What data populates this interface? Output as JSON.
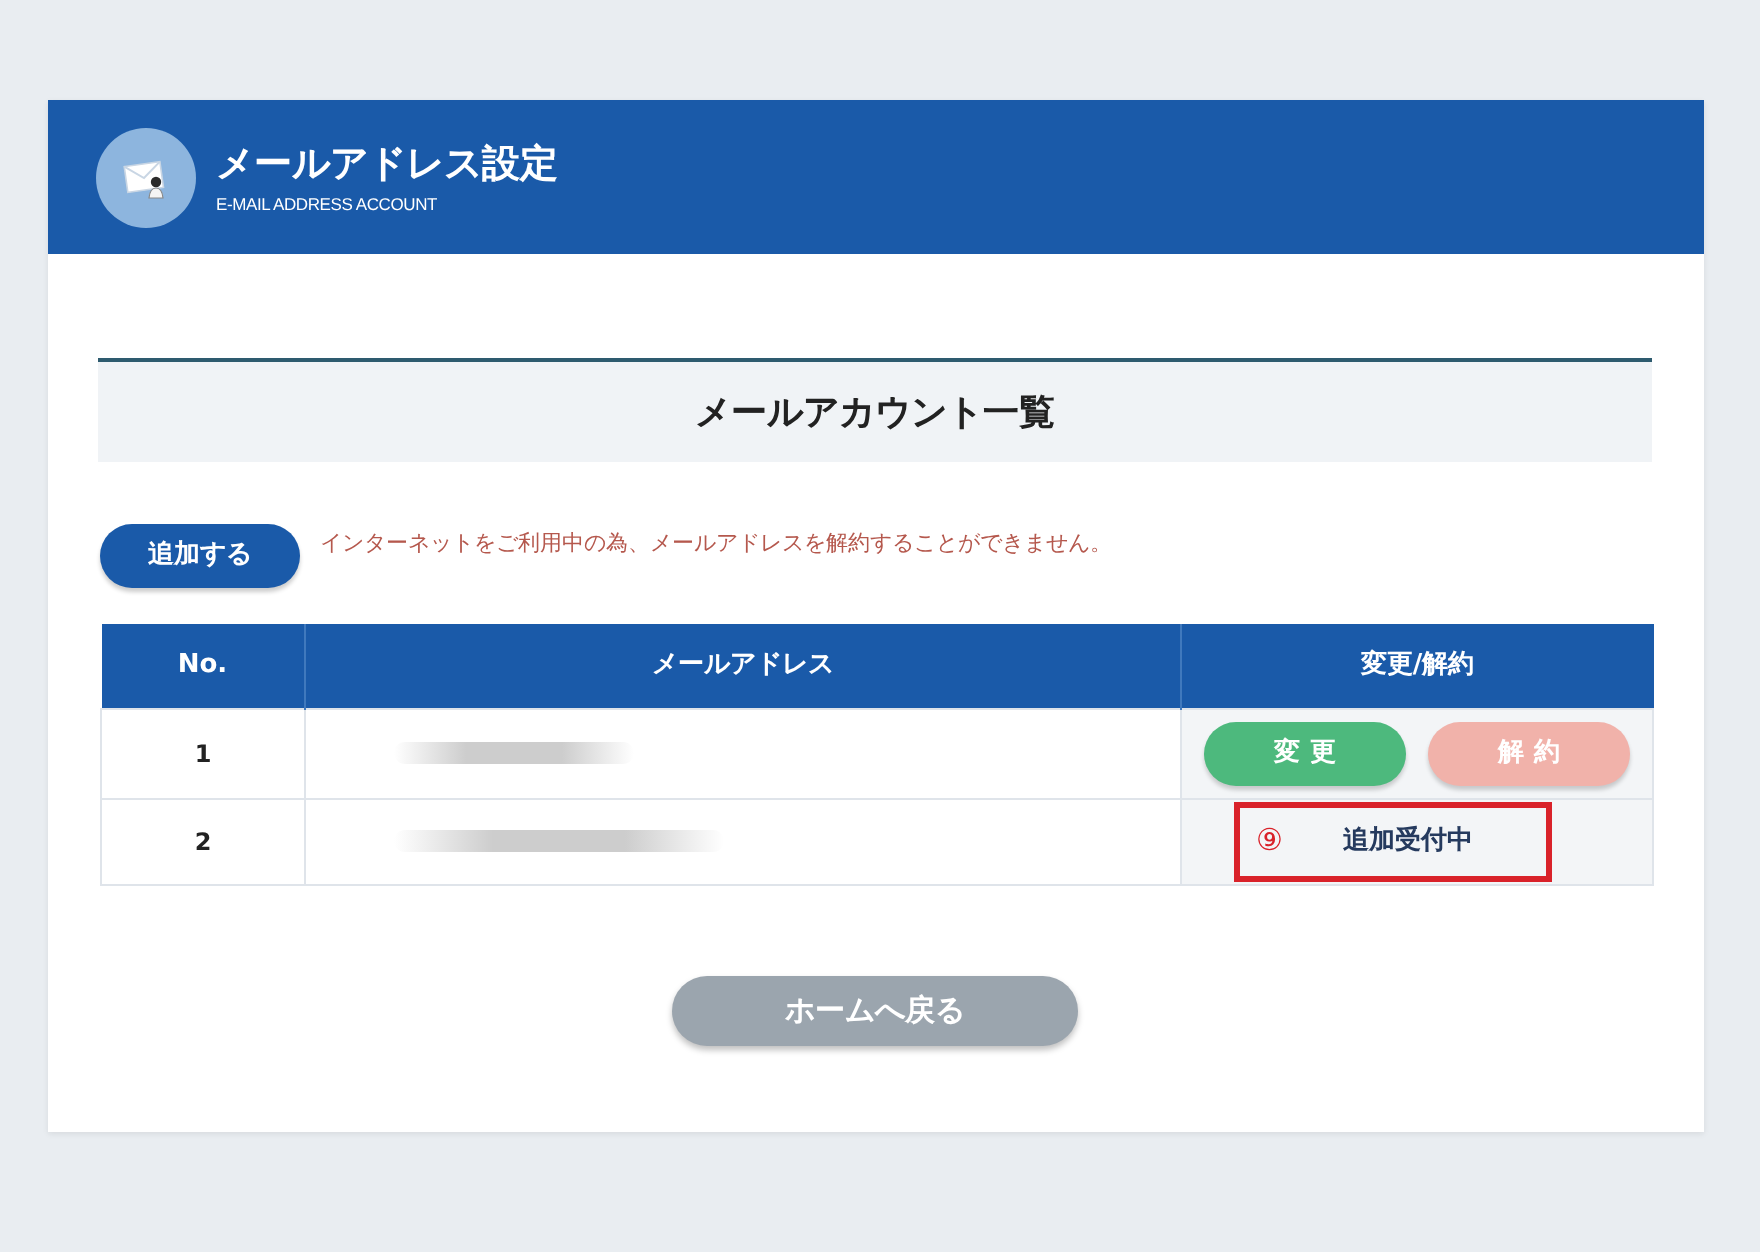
{
  "header": {
    "title": "メールアドレス設定",
    "subtitle": "E-MAIL ADDRESS ACCOUNT"
  },
  "section": {
    "title": "メールアカウント一覧"
  },
  "add_button": {
    "label": "追加する"
  },
  "notice": "インターネットをご利用中の為、メールアドレスを解約することができません。",
  "table": {
    "columns": [
      "No.",
      "メールアドレス",
      "変更/解約"
    ],
    "rows": [
      {
        "no": "1",
        "email_redacted": true,
        "kind": "actions",
        "actions": [
          {
            "label": "変更",
            "kind": "change",
            "disabled": false
          },
          {
            "label": "解約",
            "kind": "cancel",
            "disabled": true
          }
        ]
      },
      {
        "no": "2",
        "email_redacted": true,
        "kind": "status",
        "status": "追加受付中",
        "annotation": {
          "label": "⑨"
        }
      }
    ]
  },
  "home_button": {
    "label": "ホームへ戻る"
  }
}
